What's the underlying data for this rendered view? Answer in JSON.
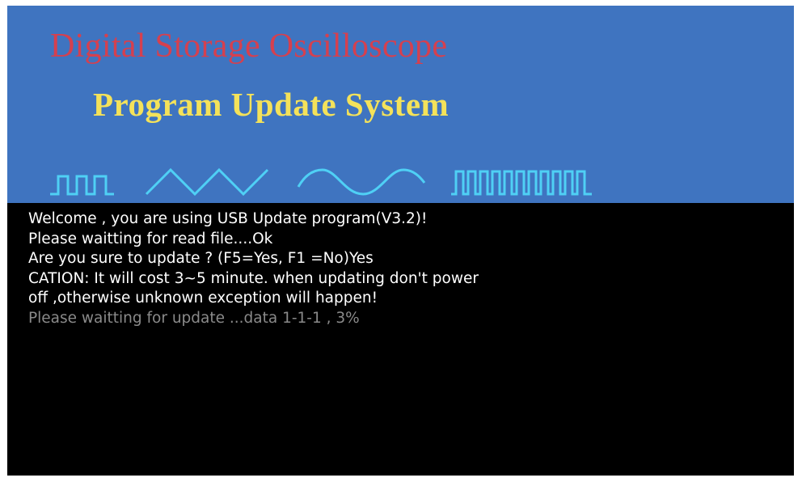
{
  "banner": {
    "title": "Digital Storage Oscilloscope",
    "subtitle": "Program Update System",
    "waveforms": [
      "square-wave-icon",
      "triangle-wave-icon",
      "sine-wave-icon",
      "pulse-train-icon"
    ]
  },
  "console": {
    "lines": [
      "Welcome , you are using USB Update program(V3.2)!",
      "Please waitting for read file....Ok",
      "Are you sure to update ? (F5=Yes, F1 =No)Yes",
      "CATION: It will cost 3~5 minute. when updating don't power",
      "off ,otherwise unknown exception will happen!",
      "Please waitting for update ...data 1-1-1 , 3%"
    ]
  },
  "colors": {
    "banner_background": "#3f74c0",
    "title": "#d5404f",
    "subtitle": "#f4e25a",
    "waveform": "#4fd0f5",
    "console_background": "#000000",
    "console_text": "#ffffff",
    "progress_text": "#8a8a8a"
  }
}
